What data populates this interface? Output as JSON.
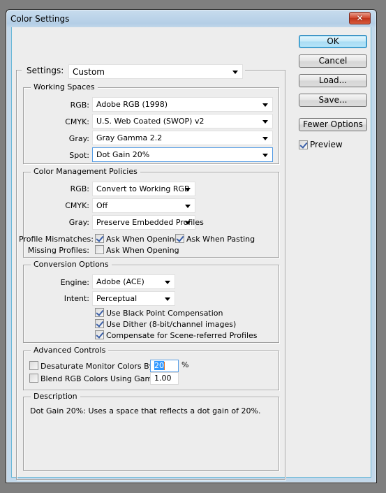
{
  "window": {
    "title": "Color Settings",
    "close_label": "✕"
  },
  "buttons": {
    "ok": "OK",
    "cancel": "Cancel",
    "load": "Load...",
    "save": "Save...",
    "fewer_options": "Fewer Options"
  },
  "preview": {
    "label": "Preview",
    "checked": true
  },
  "settings": {
    "label": "Settings:",
    "value": "Custom"
  },
  "working_spaces": {
    "title": "Working Spaces",
    "rgb": {
      "label": "RGB:",
      "value": "Adobe RGB (1998)"
    },
    "cmyk": {
      "label": "CMYK:",
      "value": "U.S. Web Coated (SWOP) v2"
    },
    "gray": {
      "label": "Gray:",
      "value": "Gray Gamma 2.2"
    },
    "spot": {
      "label": "Spot:",
      "value": "Dot Gain 20%"
    }
  },
  "policies": {
    "title": "Color Management Policies",
    "rgb": {
      "label": "RGB:",
      "value": "Convert to Working RGB"
    },
    "cmyk": {
      "label": "CMYK:",
      "value": "Off"
    },
    "gray": {
      "label": "Gray:",
      "value": "Preserve Embedded Profiles"
    },
    "profile_mismatches": {
      "label": "Profile Mismatches:",
      "ask_opening": {
        "label": "Ask When Opening",
        "checked": true
      },
      "ask_pasting": {
        "label": "Ask When Pasting",
        "checked": true
      }
    },
    "missing_profiles": {
      "label": "Missing Profiles:",
      "ask_opening": {
        "label": "Ask When Opening",
        "checked": false
      }
    }
  },
  "conversion": {
    "title": "Conversion Options",
    "engine": {
      "label": "Engine:",
      "value": "Adobe (ACE)"
    },
    "intent": {
      "label": "Intent:",
      "value": "Perceptual"
    },
    "black_point": {
      "label": "Use Black Point Compensation",
      "checked": true
    },
    "dither": {
      "label": "Use Dither (8-bit/channel images)",
      "checked": true
    },
    "scene_referred": {
      "label": "Compensate for Scene-referred Profiles",
      "checked": true
    }
  },
  "advanced": {
    "title": "Advanced Controls",
    "desaturate": {
      "label": "Desaturate Monitor Colors By:",
      "checked": false,
      "value": "20",
      "unit": "%"
    },
    "blend": {
      "label": "Blend RGB Colors Using Gamma:",
      "checked": false,
      "value": "1.00"
    }
  },
  "description": {
    "title": "Description",
    "text": "Dot Gain 20%:  Uses a space that reflects a dot gain of 20%."
  }
}
